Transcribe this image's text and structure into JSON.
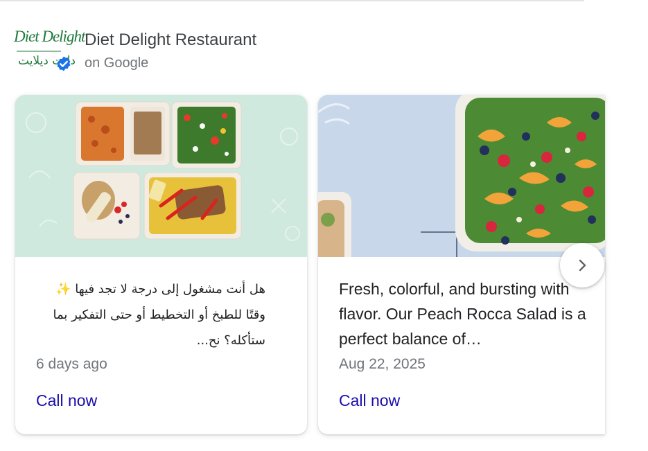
{
  "business": {
    "name": "Diet Delight Restaurant",
    "source": "on Google",
    "logo_text_en": "Diet Delight",
    "logo_text_ar": "دايت ديلايت"
  },
  "posts": [
    {
      "text": "هل أنت مشغول إلى درجة لا تجد فيها ✨ وقتًا للطبخ أو التخطيط أو حتى التفكير بما ستأكله؟ نح...",
      "date": "6 days ago",
      "cta": "Call now"
    },
    {
      "text": "Fresh, colorful, and bursting with flavor. Our Peach Rocca Salad is a perfect balance of…",
      "date": "Aug 22, 2025",
      "cta": "Call now"
    }
  ],
  "icons": {
    "verified": "verified-check-icon",
    "next": "chevron-right-icon"
  },
  "colors": {
    "link": "#1a0dab",
    "verified": "#1a73e8",
    "logo": "#1f7a3a",
    "card1_bg": "#cfe9df",
    "card2_bg": "#c9d7ea"
  }
}
